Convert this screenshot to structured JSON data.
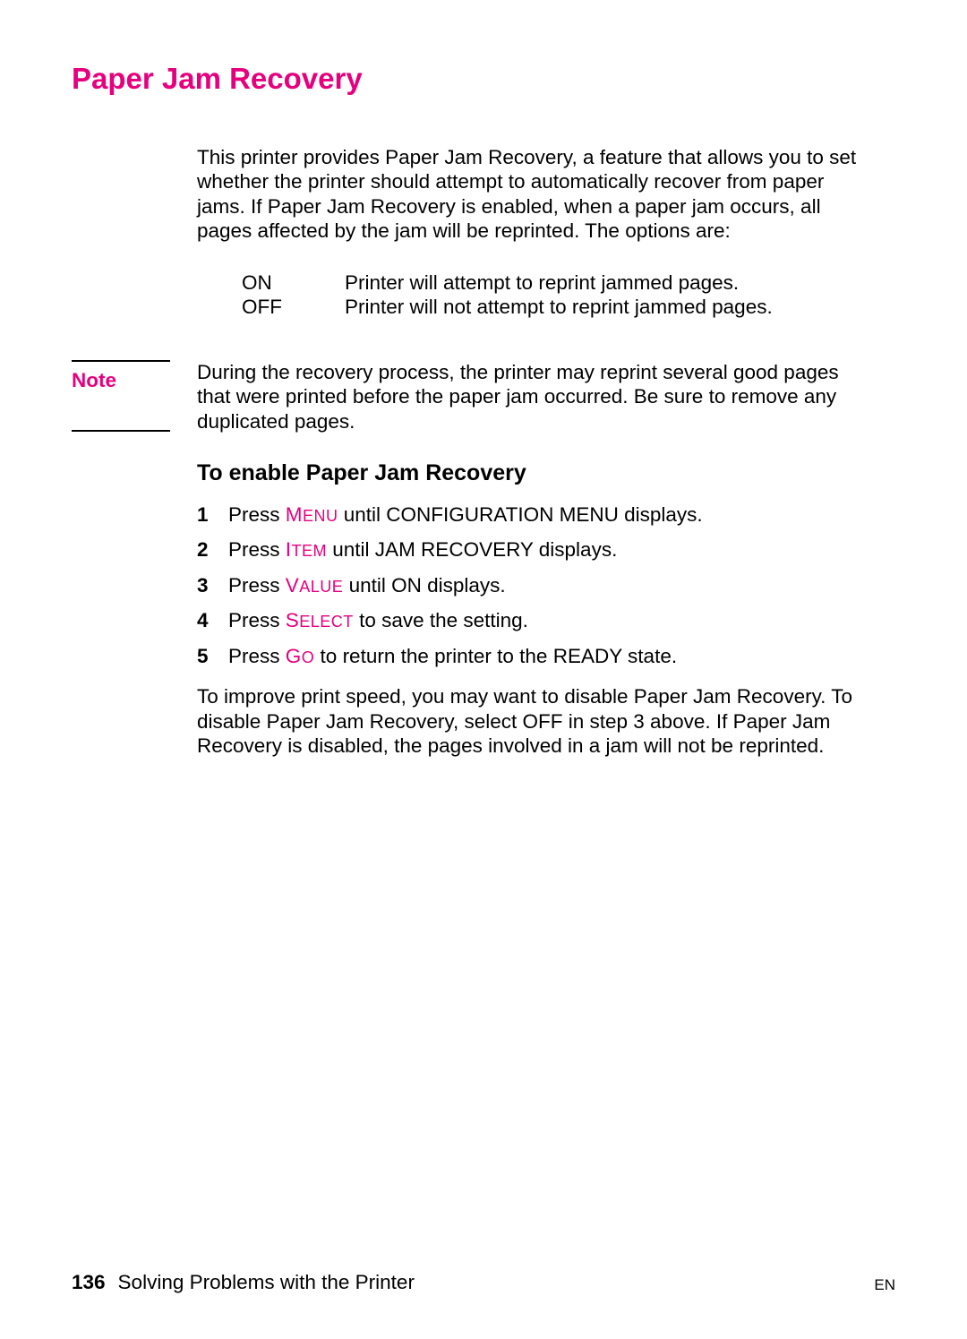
{
  "heading": "Paper Jam Recovery",
  "intro": "This printer provides Paper Jam Recovery, a feature that allows you to set whether the printer should attempt to automatically recover from paper jams. If Paper Jam Recovery is enabled, when a paper jam occurs, all pages affected by the jam will be reprinted. The options are:",
  "options": [
    {
      "label": "ON",
      "desc": "Printer will attempt to reprint jammed pages."
    },
    {
      "label": "OFF",
      "desc": "Printer will not attempt to reprint jammed pages."
    }
  ],
  "note": {
    "label": "Note",
    "body": "During the recovery process, the printer may reprint several good pages that were printed before the paper jam occurred. Be sure to remove any duplicated pages."
  },
  "subheading": "To enable Paper Jam Recovery",
  "steps": [
    {
      "num": "1",
      "prefix": "Press ",
      "hw_first": "M",
      "hw_rest": "ENU",
      "suffix": " until CONFIGURATION MENU displays."
    },
    {
      "num": "2",
      "prefix": "Press ",
      "hw_first": "I",
      "hw_rest": "TEM",
      "suffix": " until JAM RECOVERY displays."
    },
    {
      "num": "3",
      "prefix": "Press ",
      "hw_first": "V",
      "hw_rest": "ALUE",
      "suffix": " until ON displays."
    },
    {
      "num": "4",
      "prefix": "Press ",
      "hw_first": "S",
      "hw_rest": "ELECT",
      "suffix": " to save the setting."
    },
    {
      "num": "5",
      "prefix": "Press ",
      "hw_first": "G",
      "hw_rest": "O",
      "suffix": " to return the printer to the READY state."
    }
  ],
  "closing": "To improve print speed, you may want to disable Paper Jam Recovery. To disable Paper Jam Recovery, select OFF in step 3 above. If Paper Jam Recovery is disabled, the pages involved in a jam will not be reprinted.",
  "footer": {
    "page": "136",
    "section": "Solving Problems with the Printer",
    "lang": "EN"
  }
}
